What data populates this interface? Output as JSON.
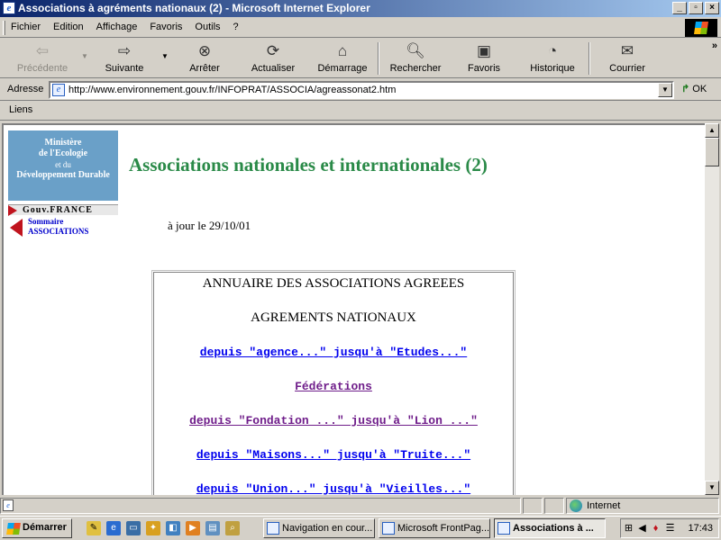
{
  "window": {
    "title": "Associations à agréments nationaux (2) - Microsoft Internet Explorer",
    "controls": [
      "_",
      "▫",
      "×"
    ]
  },
  "menu": [
    "Fichier",
    "Edition",
    "Affichage",
    "Favoris",
    "Outils",
    "?"
  ],
  "toolbar": {
    "back": "Précédente",
    "forward": "Suivante",
    "stop": "Arrêter",
    "refresh": "Actualiser",
    "home": "Démarrage",
    "search": "Rechercher",
    "favorites": "Favoris",
    "history": "Historique",
    "mail": "Courrier",
    "more": "»"
  },
  "address": {
    "label": "Adresse",
    "url": "http://www.environnement.gouv.fr/INFOPRAT/ASSOCIA/agreassonat2.htm",
    "go": "OK"
  },
  "links_bar": {
    "label": "Liens"
  },
  "page": {
    "logo_lines": [
      "Ministère",
      "de l'Ecologie",
      "et du",
      "Développement Durable"
    ],
    "gouv": "Gouv.FRANCE",
    "back_links": [
      "Sommaire",
      "ASSOCIATIONS"
    ],
    "title": "Associations nationales et internationales (2)",
    "update": "à jour le 29/10/01",
    "annuaire": {
      "heading": "ANNUAIRE DES ASSOCIATIONS AGREEES",
      "subheading": "AGREMENTS NATIONAUX",
      "links": [
        {
          "text": "depuis \"agence...\" jusqu'à \"Etudes...\"",
          "state": "unvisited"
        },
        {
          "text": "Fédérations",
          "state": "visited"
        },
        {
          "text": "depuis \"Fondation ...\" jusqu'à \"Lion ...\"",
          "state": "visited"
        },
        {
          "text": "depuis \"Maisons...\" jusqu'à \"Truite...\"",
          "state": "unvisited"
        },
        {
          "text": "depuis \"Union...\" jusqu'à \"Vieilles...\"",
          "state": "unvisited"
        }
      ]
    }
  },
  "status": {
    "zone": "Internet"
  },
  "taskbar": {
    "start": "Démarrer",
    "tasks": [
      "Navigation en cour...",
      "Microsoft FrontPag...",
      "Associations à ..."
    ],
    "clock": "17:43"
  }
}
